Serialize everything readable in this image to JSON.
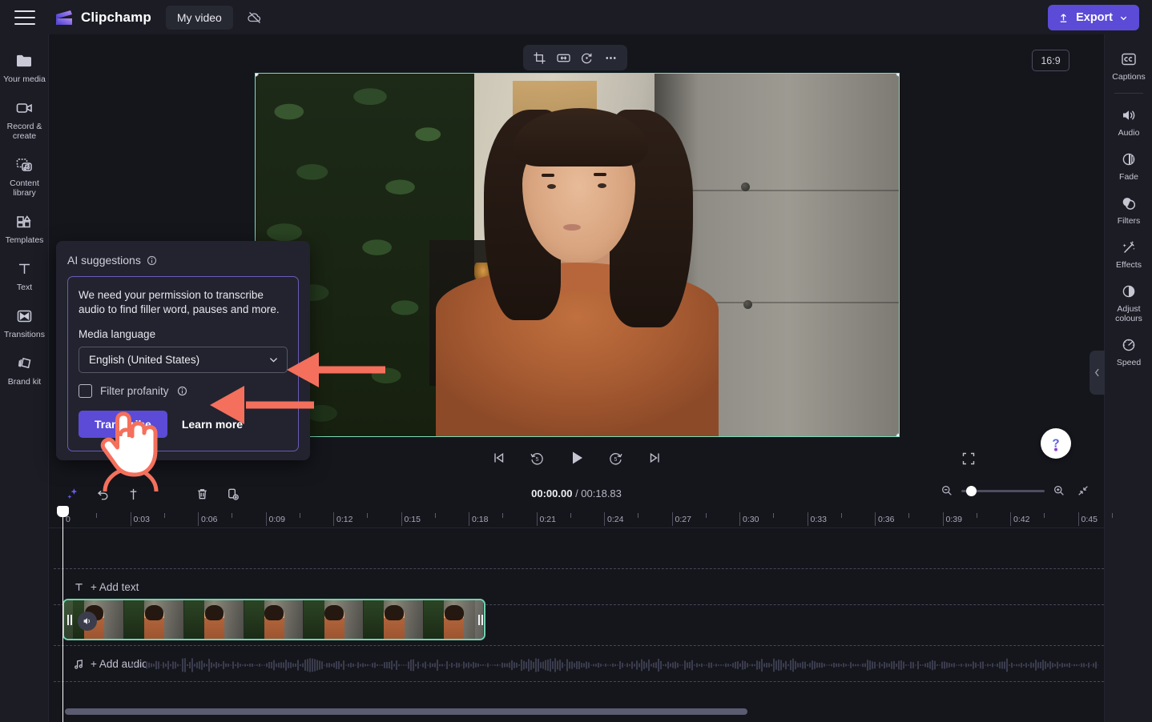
{
  "app": {
    "brand_name": "Clipchamp",
    "project_name": "My video",
    "accent": "#5b4bd6",
    "clip_border": "#6fd3ae",
    "annotation_color": "#f4705c",
    "bg": "#15161c",
    "panel_bg": "#1b1c24"
  },
  "header": {
    "menu_icon": "hamburger-icon",
    "logo_icon": "clipchamp-logo-icon",
    "cloud_icon": "cloud-off-icon",
    "export_label": "Export",
    "export_icon": "upload-icon",
    "export_caret_icon": "chevron-down-icon"
  },
  "left_rail": {
    "items": [
      {
        "label": "Your media",
        "icon": "folder-icon"
      },
      {
        "label": "Record & create",
        "icon": "video-camera-icon"
      },
      {
        "label": "Content library",
        "icon": "media-library-icon"
      },
      {
        "label": "Templates",
        "icon": "templates-grid-icon"
      },
      {
        "label": "Text",
        "icon": "text-t-icon"
      },
      {
        "label": "Transitions",
        "icon": "transitions-icon"
      },
      {
        "label": "Brand kit",
        "icon": "brand-kit-icon"
      }
    ]
  },
  "right_rail": {
    "items": [
      {
        "label": "Captions",
        "icon": "cc-icon"
      },
      {
        "label": "Audio",
        "icon": "speaker-icon"
      },
      {
        "label": "Fade",
        "icon": "fade-circle-icon"
      },
      {
        "label": "Filters",
        "icon": "filters-overlap-icon"
      },
      {
        "label": "Effects",
        "icon": "magic-wand-icon"
      },
      {
        "label": "Adjust colours",
        "icon": "contrast-circle-icon"
      },
      {
        "label": "Speed",
        "icon": "speedometer-icon"
      }
    ]
  },
  "stage": {
    "float_toolbar": [
      {
        "icon": "crop-icon"
      },
      {
        "icon": "fit-fill-icon"
      },
      {
        "icon": "rotate-icon"
      },
      {
        "icon": "more-ellipsis-icon"
      }
    ],
    "aspect_ratio": "16:9",
    "collapse_icon": "chevron-left-icon",
    "help_icon": "question-mark-icon",
    "help_tab_icon": "chevron-down-icon"
  },
  "player": {
    "controls": [
      {
        "icon": "skip-to-start-icon"
      },
      {
        "icon": "rewind-5-icon"
      },
      {
        "icon": "play-icon"
      },
      {
        "icon": "forward-5-icon"
      },
      {
        "icon": "skip-to-end-icon"
      }
    ],
    "fullscreen_icon": "fullscreen-icon"
  },
  "timeline": {
    "tools": [
      {
        "icon": "ai-sparkle-icon"
      },
      {
        "icon": "undo-icon"
      },
      {
        "icon": "split-icon"
      },
      {
        "icon": "delete-trash-icon"
      },
      {
        "icon": "duplicate-icon"
      }
    ],
    "current_time": "00:00.00",
    "total_time": "/ 00:18.83",
    "zoom_out_icon": "zoom-out-icon",
    "zoom_in_icon": "zoom-in-icon",
    "fit_icon": "fit-timeline-icon",
    "ruler_labels": [
      "0",
      "0:03",
      "0:06",
      "0:09",
      "0:12",
      "0:15",
      "0:18",
      "0:21",
      "0:24",
      "0:27",
      "0:30",
      "0:33",
      "0:36",
      "0:39",
      "0:42",
      "0:45"
    ],
    "text_track_label": "+ Add text",
    "text_track_icon": "text-t-icon",
    "audio_track_label": "+ Add audio",
    "audio_track_icon": "music-note-icon",
    "clip_audio_icon": "speaker-icon"
  },
  "ai_popup": {
    "title": "AI suggestions",
    "title_info_icon": "info-icon",
    "description": "We need your permission to transcribe audio to find filler word, pauses and more.",
    "language_label": "Media language",
    "language_value": "English (United States)",
    "language_caret_icon": "chevron-down-icon",
    "profanity_label": "Filter profanity",
    "profanity_info_icon": "info-icon",
    "profanity_checked": false,
    "transcribe_label": "Transcribe",
    "learn_more_label": "Learn more"
  },
  "annotations": {
    "arrow_to_language_dropdown": "arrow-left-icon",
    "arrow_to_filter_profanity": "arrow-left-icon",
    "hand_cursor": "hand-pointer-icon",
    "split_highlight": "split-button-highlight"
  }
}
